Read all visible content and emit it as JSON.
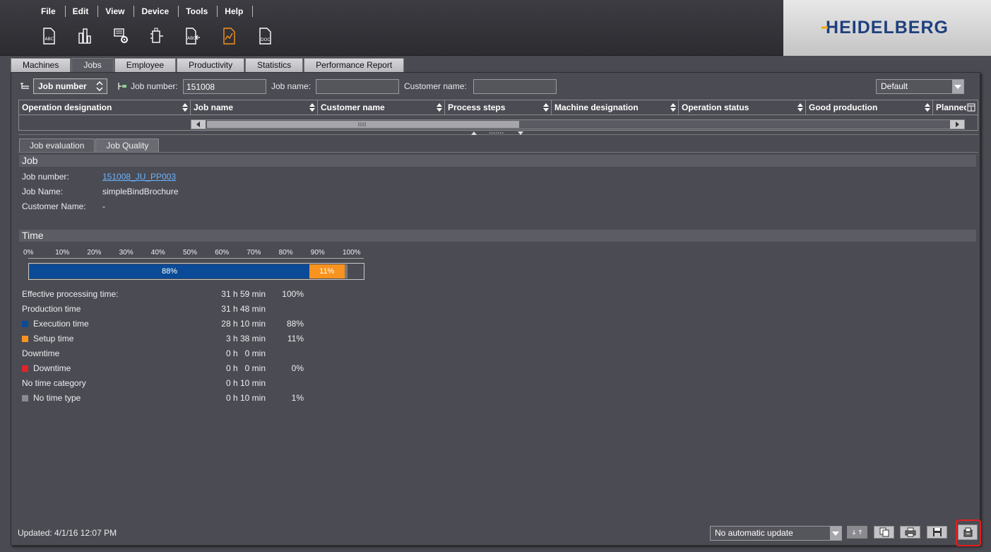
{
  "menu": [
    "File",
    "Edit",
    "View",
    "Device",
    "Tools",
    "Help"
  ],
  "toolbar_icons": [
    "report-abc-icon",
    "machine-chart-icon",
    "device-settings-icon",
    "machine-config-icon",
    "import-abc-icon",
    "evaluation-icon",
    "export-doc-icon"
  ],
  "logo": {
    "text": "HEIDELBERG",
    "color": "#1d3f7e",
    "accent": "#f2a900"
  },
  "main_tabs": [
    "Machines",
    "Jobs",
    "Employee",
    "Productivity",
    "Statistics",
    "Performance Report"
  ],
  "active_main_tab": "Jobs",
  "filter": {
    "search_type": "Job number",
    "job_number_label": "Job number:",
    "job_number_value": "151008",
    "job_name_label": "Job name:",
    "job_name_value": "",
    "customer_name_label": "Customer name:",
    "customer_name_value": "",
    "view_preset": "Default"
  },
  "table": {
    "columns": [
      "Operation designation",
      "Job name",
      "Customer name",
      "Process steps",
      "Machine designation",
      "Operation status",
      "Good production",
      "Planned"
    ]
  },
  "sub_tabs": [
    "Job evaluation",
    "Job Quality"
  ],
  "active_sub_tab": "Job Quality",
  "job_section": {
    "title": "Job",
    "job_number_label": "Job number:",
    "job_number_value": "151008_JU_PP003",
    "job_name_label": "Job Name:",
    "job_name_value": "simpleBindBrochure",
    "customer_name_label": "Customer Name:",
    "customer_name_value": "-"
  },
  "time_section": {
    "title": "Time",
    "scale_ticks": [
      "0%",
      "10%",
      "20%",
      "30%",
      "40%",
      "50%",
      "60%",
      "70%",
      "80%",
      "90%",
      "100%"
    ],
    "bar": [
      {
        "label": "88%",
        "value": 0.88,
        "color": "#0a4a96"
      },
      {
        "label": "11%",
        "value": 0.11,
        "color": "#f7931e"
      },
      {
        "label": "",
        "value": 0.01,
        "color": "#7a7a82"
      }
    ],
    "rows": [
      {
        "label": "Effective processing time:",
        "duration": "31 h 59 min",
        "percent": "100%",
        "swatch": ""
      },
      {
        "label": "Production time",
        "duration": "31 h 48 min",
        "percent": "",
        "swatch": ""
      },
      {
        "label": "Execution time",
        "duration": "28 h 10 min",
        "percent": "88%",
        "swatch": "#0a4a96"
      },
      {
        "label": "Setup time",
        "duration": "3 h 38 min",
        "percent": "11%",
        "swatch": "#f7931e"
      },
      {
        "label": "Downtime",
        "duration": "0 h   0 min",
        "percent": "",
        "swatch": ""
      },
      {
        "label": "Downtime",
        "duration": "0 h   0 min",
        "percent": "0%",
        "swatch": "#e0242c"
      },
      {
        "label": "No time category",
        "duration": "0 h 10 min",
        "percent": "",
        "swatch": ""
      },
      {
        "label": "No time type",
        "duration": "0 h 10 min",
        "percent": "1%",
        "swatch": "#8a8a92"
      }
    ]
  },
  "footer": {
    "updated": "Updated: 4/1/16 12:07 PM",
    "update_mode": "No automatic update"
  }
}
